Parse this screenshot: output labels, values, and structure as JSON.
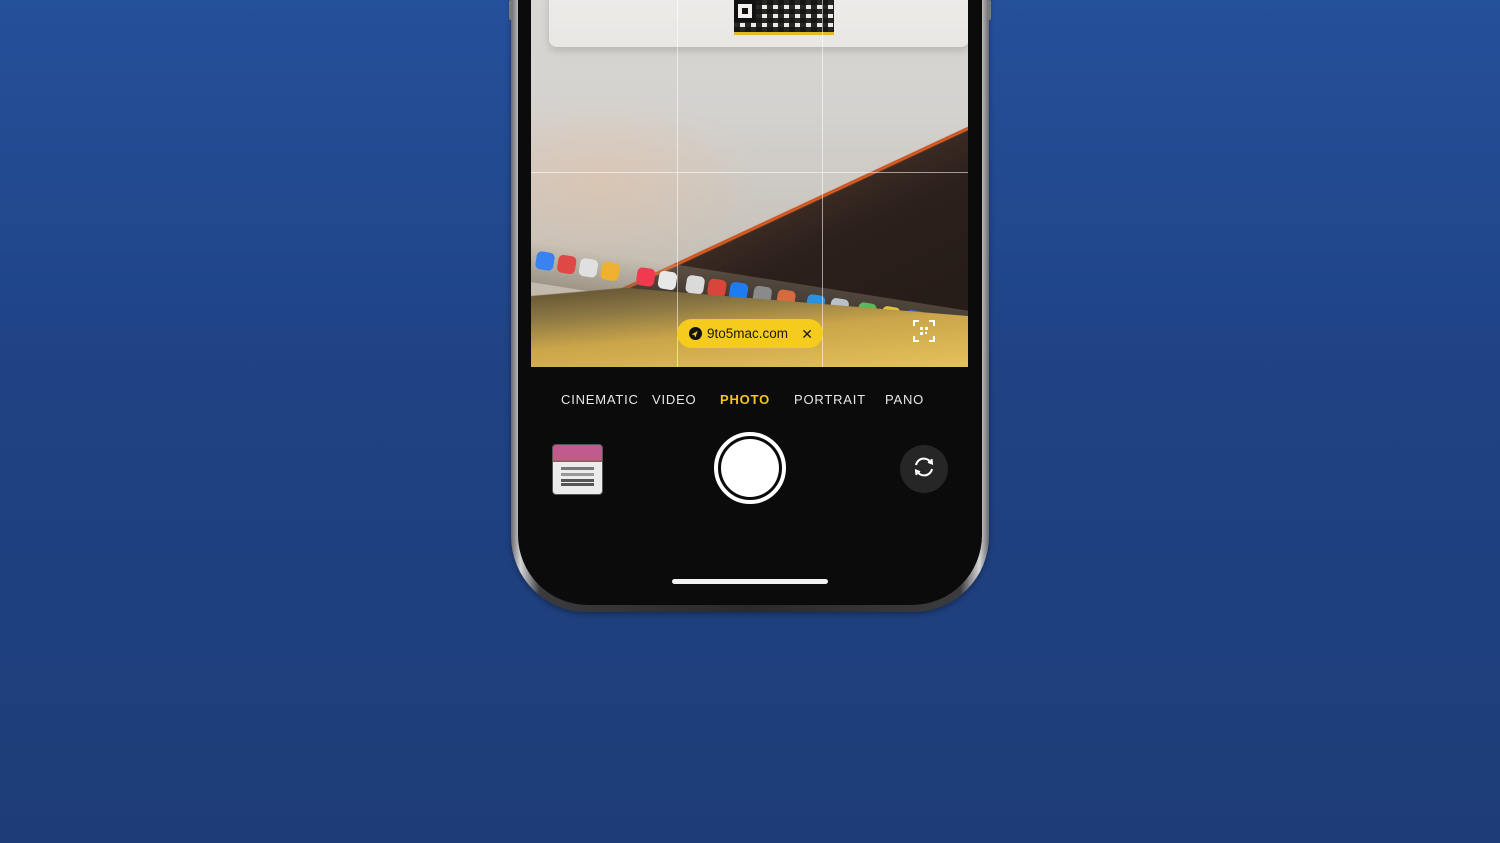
{
  "camera": {
    "qr_result": {
      "label": "9to5mac.com",
      "close_glyph": "✕",
      "icon": "compass-icon",
      "color": "#f5cc1d"
    },
    "modes": [
      "CINEMATIC",
      "VIDEO",
      "PHOTO",
      "PORTRAIT",
      "PANO"
    ],
    "active_mode": "PHOTO",
    "accent": "#f4c51c",
    "controls": {
      "shutter_icon": "shutter-button",
      "flip_icon": "camera-flip-icon",
      "scan_icon": "qr-scan-icon",
      "thumbnail_icon": "last-photo-thumbnail"
    }
  }
}
